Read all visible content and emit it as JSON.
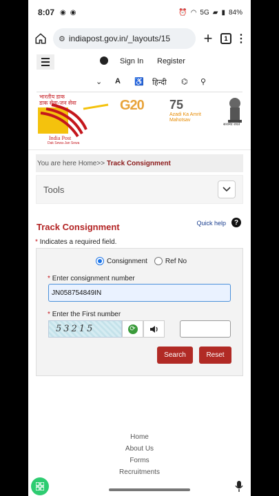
{
  "status_bar": {
    "time": "8:07",
    "network": "5G",
    "battery": "84%"
  },
  "browser": {
    "url": "indiapost.gov.in/_layouts/15",
    "tab_count": "1"
  },
  "site_nav": {
    "sign_in": "Sign In",
    "register": "Register",
    "hindi": "हिन्दी"
  },
  "logos": {
    "india_post_hindi": "भारतीय डाक",
    "india_post_tagline_hindi": "डाक सेवा-जन सेवा",
    "india_post_name": "India Post",
    "india_post_tagline": "Dak Sewa-Jan Sewa",
    "g20": "G20",
    "azadi_75": "75",
    "azadi_text": "Azadi Ka Amrit Mahotsav",
    "emblem_text": "सत्यमेव जयते"
  },
  "breadcrumb": {
    "prefix": "You are here",
    "home": "Home>>",
    "current": "Track Consignment"
  },
  "tools": {
    "label": "Tools"
  },
  "form": {
    "title": "Track Consignment",
    "quick_help": "Quick help",
    "required_note": "Indicates a required field.",
    "radio_consignment": "Consignment",
    "radio_ref_no": "Ref No",
    "consignment_label": "Enter consignment number",
    "consignment_value": "JN058754849IN",
    "first_number_label": "Enter the First number",
    "captcha_text": "53215",
    "search_button": "Search",
    "reset_button": "Reset"
  },
  "footer": {
    "links": [
      "Home",
      "About Us",
      "Forms",
      "Recruitments"
    ]
  },
  "colors": {
    "accent_red": "#b12a25",
    "title_red": "#b22222",
    "link_blue": "#1a3e8f"
  }
}
